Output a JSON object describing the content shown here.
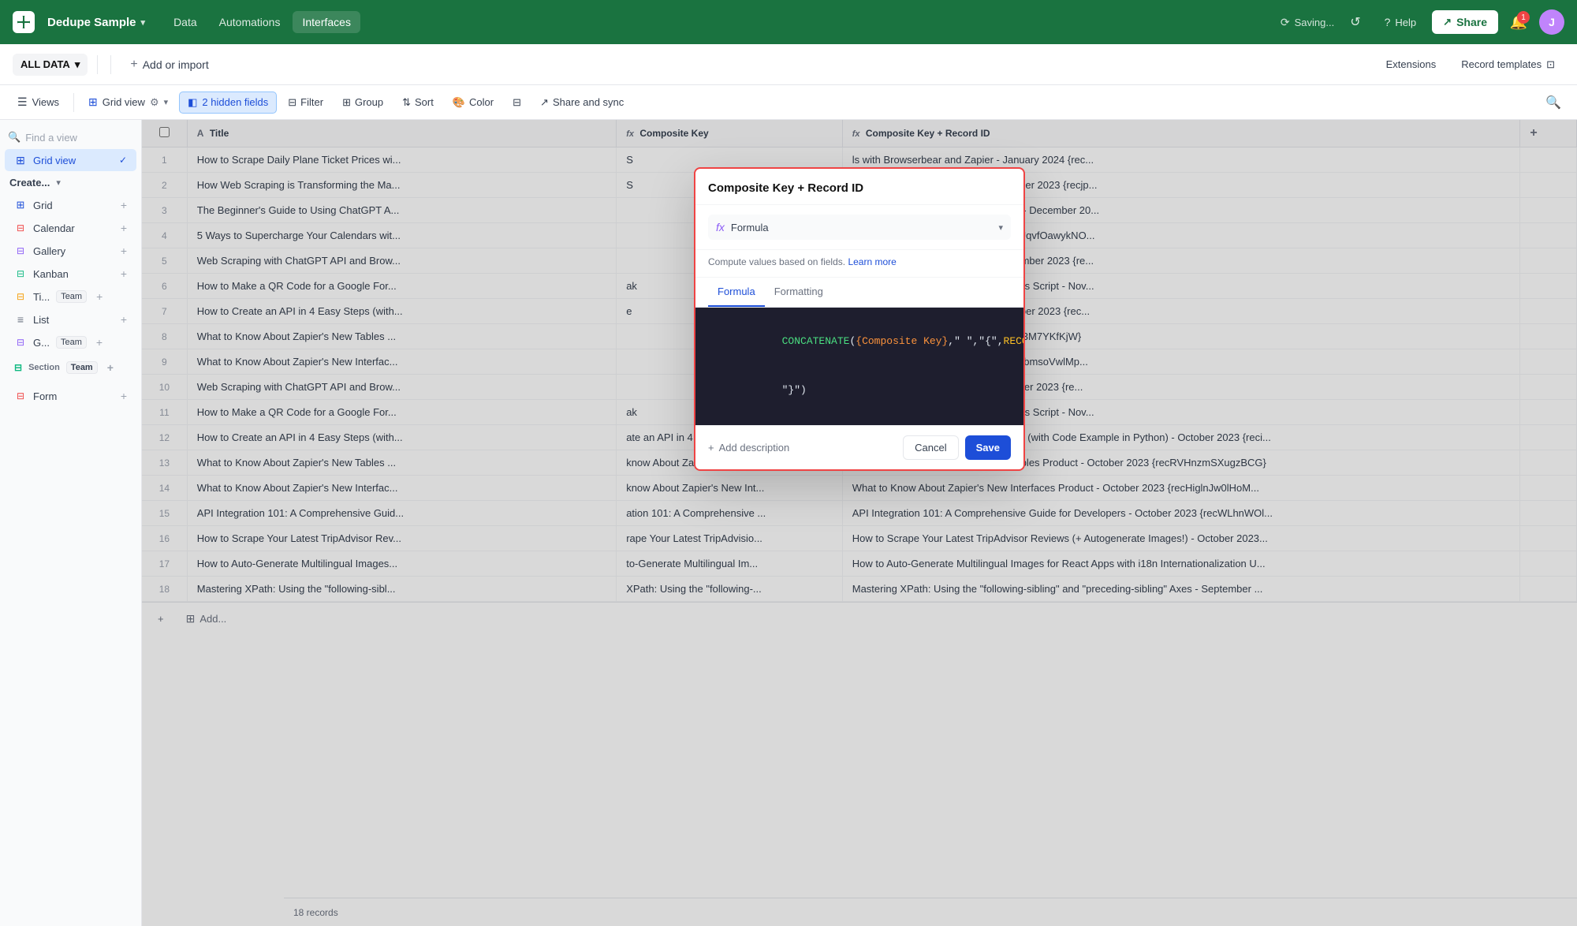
{
  "app": {
    "name": "Dedupe Sample",
    "logo_char": "D"
  },
  "nav": {
    "data_label": "Data",
    "automations_label": "Automations",
    "interfaces_label": "Interfaces",
    "saving_label": "Saving...",
    "help_label": "Help",
    "share_label": "Share",
    "notif_count": "1",
    "avatar_char": "J"
  },
  "toolbar": {
    "all_data_label": "ALL DATA",
    "add_import_label": "Add or import",
    "extensions_label": "Extensions",
    "record_templates_label": "Record templates"
  },
  "views_toolbar": {
    "views_label": "Views",
    "grid_view_label": "Grid view",
    "hidden_fields_label": "2 hidden fields",
    "filter_label": "Filter",
    "group_label": "Group",
    "sort_label": "Sort",
    "color_label": "Color",
    "share_sync_label": "Share and sync"
  },
  "sidebar": {
    "find_placeholder": "Find a view",
    "grid_view_label": "Grid view",
    "create_label": "Create...",
    "items": [
      {
        "id": "grid",
        "label": "Grid",
        "icon": "⊞",
        "color": "#1d4ed8"
      },
      {
        "id": "calendar",
        "label": "Calendar",
        "icon": "📅",
        "color": "#ef4444"
      },
      {
        "id": "gallery",
        "label": "Gallery",
        "icon": "⊟",
        "color": "#8b5cf6"
      },
      {
        "id": "kanban",
        "label": "Kanban",
        "icon": "⊟",
        "color": "#10b981"
      },
      {
        "id": "timeline",
        "label": "Ti...",
        "icon": "⊟",
        "color": "#f59e0b",
        "team": "Team"
      },
      {
        "id": "list",
        "label": "List",
        "icon": "≡",
        "color": "#6b7280"
      },
      {
        "id": "gallery2",
        "label": "G...",
        "icon": "⊟",
        "color": "#8b5cf6",
        "team": "Team"
      },
      {
        "id": "form",
        "label": "Form",
        "icon": "⊟",
        "color": "#ef4444"
      }
    ],
    "section_label": "Section",
    "team_tag": "Team"
  },
  "table": {
    "columns": [
      {
        "id": "check",
        "label": ""
      },
      {
        "id": "title",
        "label": "Title",
        "icon": "A"
      },
      {
        "id": "composite_key",
        "label": "Composite Key",
        "icon": "fx"
      },
      {
        "id": "composite_key_record_id",
        "label": "Composite Key + Record ID",
        "icon": "fx"
      }
    ],
    "rows": [
      {
        "num": 1,
        "title": "How to Scrape Daily Plane Ticket Prices wi...",
        "ck": "S",
        "ckrid": "ls with Browserbear and Zapier - January 2024 {rec..."
      },
      {
        "num": 2,
        "title": "How Web Scraping is Transforming the Ma...",
        "ck": "S",
        "ckrid": "e Market Research Industry - December 2023 {recjp..."
      },
      {
        "num": 3,
        "title": "The Beginner's Guide to Using ChatGPT A...",
        "ck": "",
        "ckrid": "PT API in Python (4 Code Examples) - December 20..."
      },
      {
        "num": 4,
        "title": "5 Ways to Supercharge Your Calendars wit...",
        "ck": "",
        "ckrid": "s with Zapier - December 2023 {rec4UqvfOawykNO..."
      },
      {
        "num": 5,
        "title": "Web Scraping with ChatGPT API and Brow...",
        "ck": "",
        "ckrid": "rowserbear (Python Example) - December 2023 {re..."
      },
      {
        "num": 6,
        "title": "How to Make a QR Code for a Google For...",
        "ck": "ak",
        "ckrid": "Form Automatically Using Google Apps Script - Nov..."
      },
      {
        "num": 7,
        "title": "How to Create an API in 4 Easy Steps (with...",
        "ck": "e",
        "ckrid": "with Code Example in Python) - October 2023 {rec..."
      },
      {
        "num": 8,
        "title": "What to Know About Zapier's New Tables ...",
        "ck": "",
        "ckrid": "les Product - October 2023 {rectS8cX3M7YKfKjW}"
      },
      {
        "num": 9,
        "title": "What to Know About Zapier's New Interfac...",
        "ck": "",
        "ckrid": "rfaces Product - October 2023 {rec4ObmsoVwlMp..."
      },
      {
        "num": 10,
        "title": "Web Scraping with ChatGPT API and Brow...",
        "ck": "",
        "ckrid": "rowserbear (Python Example) - October 2023 {re..."
      },
      {
        "num": 11,
        "title": "How to Make a QR Code for a Google For...",
        "ck": "ak",
        "ckrid": "Form Automatically Using Google Apps Script - Nov..."
      },
      {
        "num": 12,
        "title": "How to Create an API in 4 Easy Steps (with...",
        "ck": "ate an API in 4 Easy Steps ...",
        "ckrid": "How to Create an API in 4 Easy Steps (with Code Example in Python) - October 2023 {reci..."
      },
      {
        "num": 13,
        "title": "What to Know About Zapier's New Tables ...",
        "ck": "know About Zapier's New Ta...",
        "ckrid": "What to Know About Zapier's New Tables Product - October 2023 {recRVHnzmSXugzBCG}"
      },
      {
        "num": 14,
        "title": "What to Know About Zapier's New Interfac...",
        "ck": "know About Zapier's New Int...",
        "ckrid": "What to Know About Zapier's New Interfaces Product - October 2023 {recHiglnJw0lHoM..."
      },
      {
        "num": 15,
        "title": "API Integration 101: A Comprehensive Guid...",
        "ck": "ation 101: A Comprehensive ...",
        "ckrid": "API Integration 101: A Comprehensive Guide for Developers - October 2023 {recWLhnWOl..."
      },
      {
        "num": 16,
        "title": "How to Scrape Your Latest TripAdvisor Rev...",
        "ck": "rape Your Latest TripAdvisio...",
        "ckrid": "How to Scrape Your Latest TripAdvisor Reviews (+ Autogenerate Images!) - October 2023..."
      },
      {
        "num": 17,
        "title": "How to Auto-Generate Multilingual Images...",
        "ck": "to-Generate Multilingual Im...",
        "ckrid": "How to Auto-Generate Multilingual Images for React Apps with i18n Internationalization U..."
      },
      {
        "num": 18,
        "title": "Mastering XPath: Using the \"following-sibl...",
        "ck": "XPath: Using the \"following-...",
        "ckrid": "Mastering XPath: Using the \"following-sibling\" and \"preceding-sibling\" Axes - September ..."
      }
    ],
    "records_count": "18 records"
  },
  "modal": {
    "title": "Composite Key + Record ID",
    "field_type_label": "Formula",
    "description": "Compute values based on fields.",
    "learn_more_label": "Learn more",
    "tab_formula": "Formula",
    "tab_formatting": "Formatting",
    "formula_code": "CONCATENATE({Composite Key},\" \",\"{\",RECORD_ID(),\n\"}\")",
    "add_description_label": "Add description",
    "cancel_label": "Cancel",
    "save_label": "Save"
  },
  "bottom": {
    "add_label": "+",
    "add_ellipsis_label": "Add..."
  }
}
